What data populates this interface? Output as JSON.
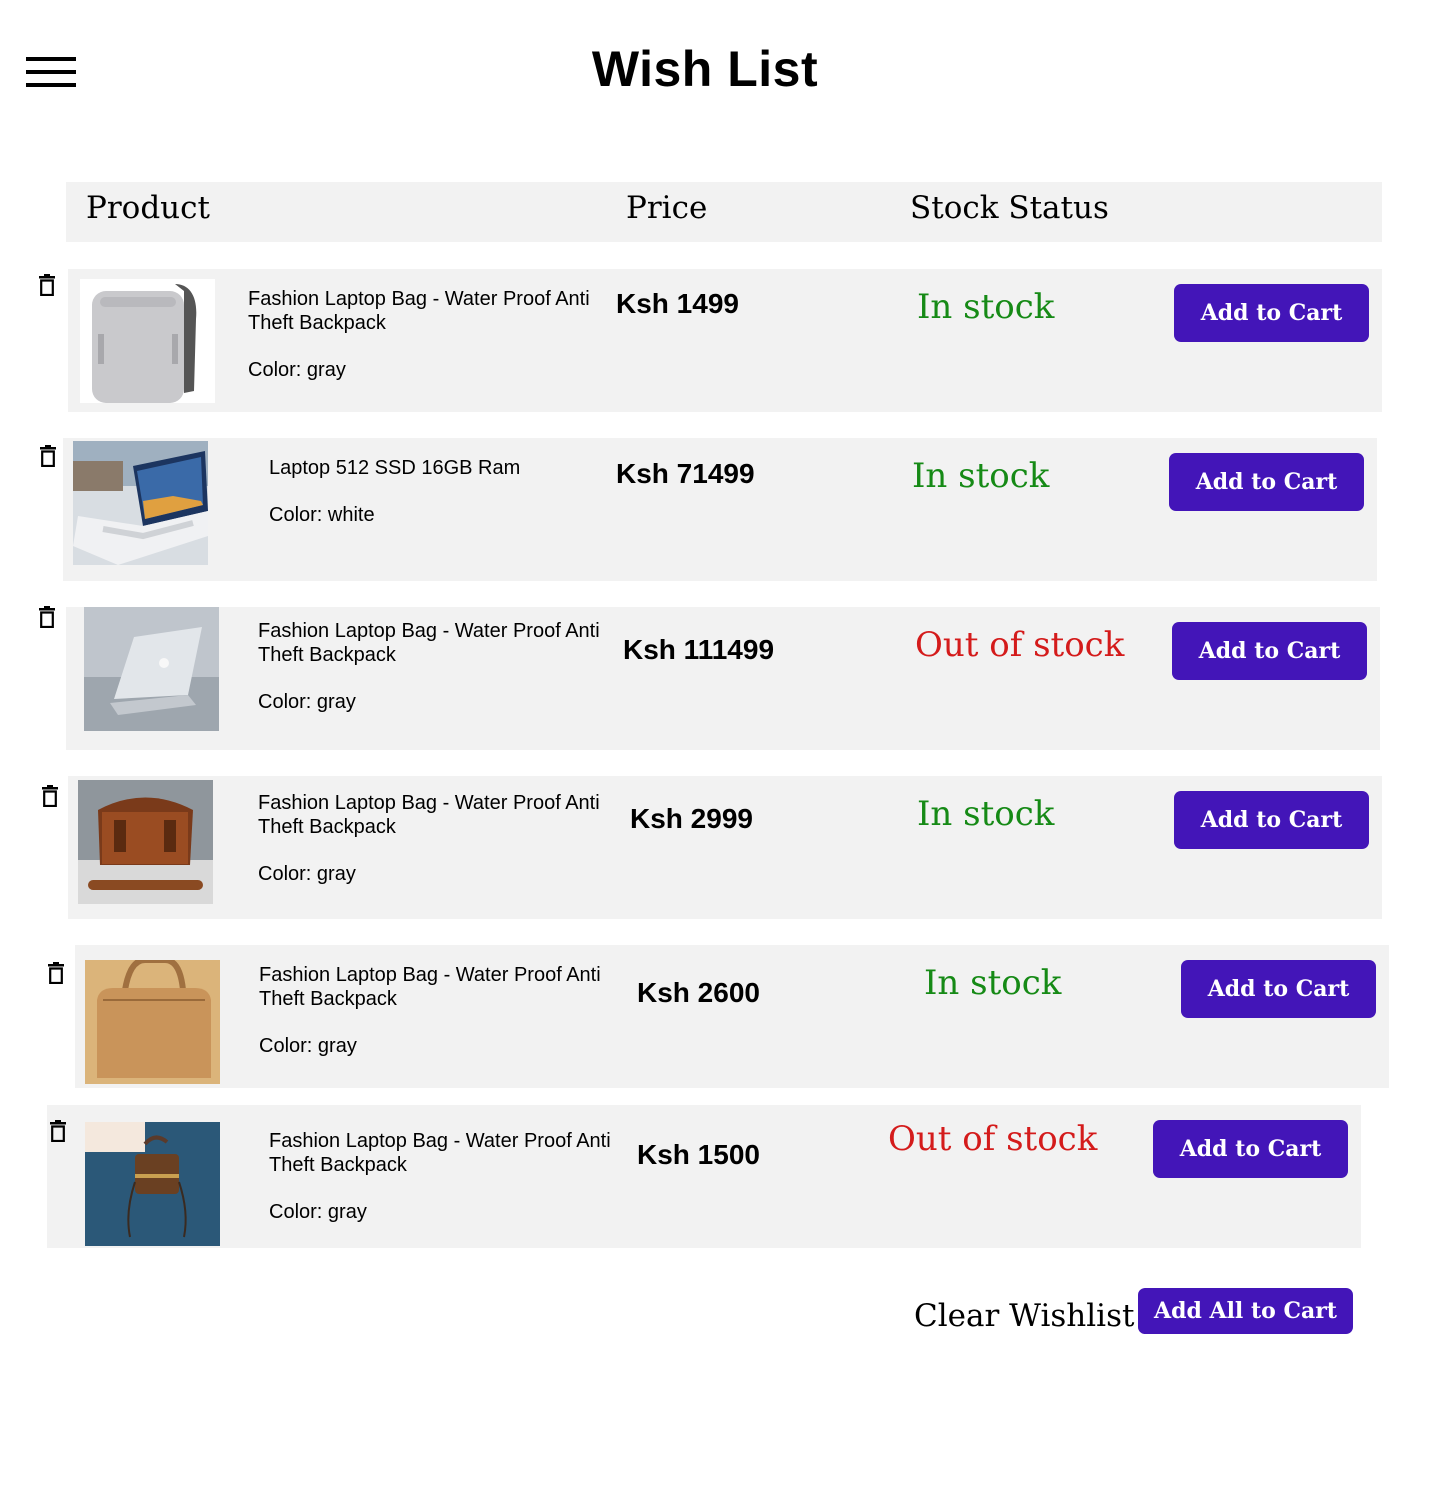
{
  "page": {
    "title": "Wish List"
  },
  "header": {
    "menu_icon": "hamburger-menu-icon"
  },
  "table": {
    "columns": [
      "Product",
      "Price",
      "Stock Status"
    ]
  },
  "colors": {
    "accent": "#4315b8",
    "in_stock": "#168a16",
    "out_of_stock": "#d41b1b",
    "row_bg": "#f2f2f2"
  },
  "items": [
    {
      "name": "Fashion Laptop Bag - Water Proof Anti Theft Backpack",
      "color": "Color: gray",
      "price": "Ksh 1499",
      "status": "In stock",
      "in_stock": true,
      "image": "gray-backpack-image",
      "button": "Add to Cart"
    },
    {
      "name": "Laptop 512 SSD 16GB Ram",
      "color": "Color: white",
      "price": "Ksh 71499",
      "status": "In stock",
      "in_stock": true,
      "image": "white-laptop-image",
      "button": "Add to Cart"
    },
    {
      "name": "Fashion Laptop Bag - Water Proof Anti Theft Backpack",
      "color": "Color: gray",
      "price": "Ksh 111499",
      "status": "Out of stock",
      "in_stock": false,
      "image": "silver-laptop-image",
      "button": "Add to Cart"
    },
    {
      "name": "Fashion Laptop Bag - Water Proof Anti Theft Backpack",
      "color": "Color: gray",
      "price": "Ksh 2999",
      "status": "In stock",
      "in_stock": true,
      "image": "brown-leather-bag-image",
      "button": "Add to Cart"
    },
    {
      "name": "Fashion Laptop Bag - Water Proof Anti Theft Backpack",
      "color": "Color: gray",
      "price": "Ksh 2600",
      "status": "In stock",
      "in_stock": true,
      "image": "cork-laptop-bag-image",
      "button": "Add to Cart"
    },
    {
      "name": "Fashion Laptop Bag - Water Proof Anti Theft Backpack",
      "color": "Color: gray",
      "price": "Ksh 1500",
      "status": "Out of stock",
      "in_stock": false,
      "image": "monogram-handbag-image",
      "button": "Add to Cart"
    }
  ],
  "footer": {
    "clear_label": "Clear Wishlist",
    "add_all_label": "Add All to Cart"
  }
}
